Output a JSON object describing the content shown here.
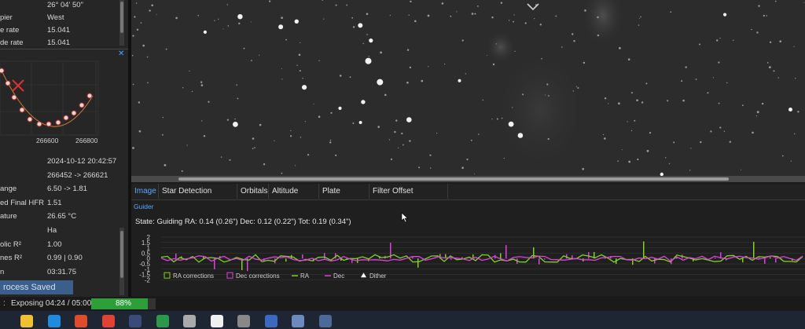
{
  "mount_info": {
    "rows": [
      {
        "label": "",
        "value": "26° 04' 50\""
      },
      {
        "label": "pier",
        "value": "West"
      },
      {
        "label": "e rate",
        "value": "15.041"
      },
      {
        "label": "de rate",
        "value": "15.041"
      }
    ]
  },
  "hfr_chart": {
    "tick_labels": [
      "266600",
      "266800"
    ]
  },
  "autofocus_info": {
    "rows": [
      {
        "label": "",
        "value": "2024-10-12 20:42:57"
      },
      {
        "label": "",
        "value": "266452 -> 266621"
      },
      {
        "label": "ange",
        "value": "6.50 -> 1.81"
      },
      {
        "label": "ed Final HFR",
        "value": "1.51"
      },
      {
        "label": "ature",
        "value": "26.65 °C"
      },
      {
        "label": "",
        "value": "Ha"
      },
      {
        "label": "olic R²",
        "value": "1.00"
      },
      {
        "label": "nes R²",
        "value": "0.99 | 0.90"
      },
      {
        "label": "n",
        "value": "03:31.75"
      }
    ],
    "process_button": "rocess Saved Run"
  },
  "tabs": [
    {
      "label": "Image",
      "active": true
    },
    {
      "label": "Star Detection Results",
      "active": false
    },
    {
      "label": "Orbitals",
      "active": false
    },
    {
      "label": "Altitude Chart",
      "active": false
    },
    {
      "label": "Plate Solving",
      "active": false
    },
    {
      "label": "Filter Offset Calculator",
      "active": false
    }
  ],
  "guider": {
    "title": "Guider",
    "state": "State: Guiding  RA: 0.14 (0.26\")  Dec: 0.12 (0.22\")  Tot: 0.19 (0.34\")",
    "y_ticks": [
      "2",
      "1.5",
      "1",
      "0.5",
      "0",
      "-0.5",
      "-1",
      "-1.5",
      "-2"
    ],
    "legend": [
      "RA corrections",
      "Dec corrections",
      "RA",
      "Dec",
      "Dither"
    ],
    "colors": {
      "ra": "#7ed321",
      "dec": "#e040e0",
      "grid": "#3a3a3a"
    }
  },
  "status_bar": {
    "prefix": ":",
    "exposing": "Exposing 04:24 / 05:00",
    "progress_percent": 88,
    "progress_label": "88%",
    "progress_color": "#2e9e3a"
  },
  "taskbar": {
    "icons": [
      "file-explorer-icon",
      "edge-icon",
      "store-icon",
      "chrome-icon",
      "astro-app-icon",
      "guide-app-icon",
      "pen-icon",
      "app-icon",
      "planet-app-icon",
      "sky-app-icon",
      "search-app-icon",
      "chart-app-icon"
    ]
  }
}
